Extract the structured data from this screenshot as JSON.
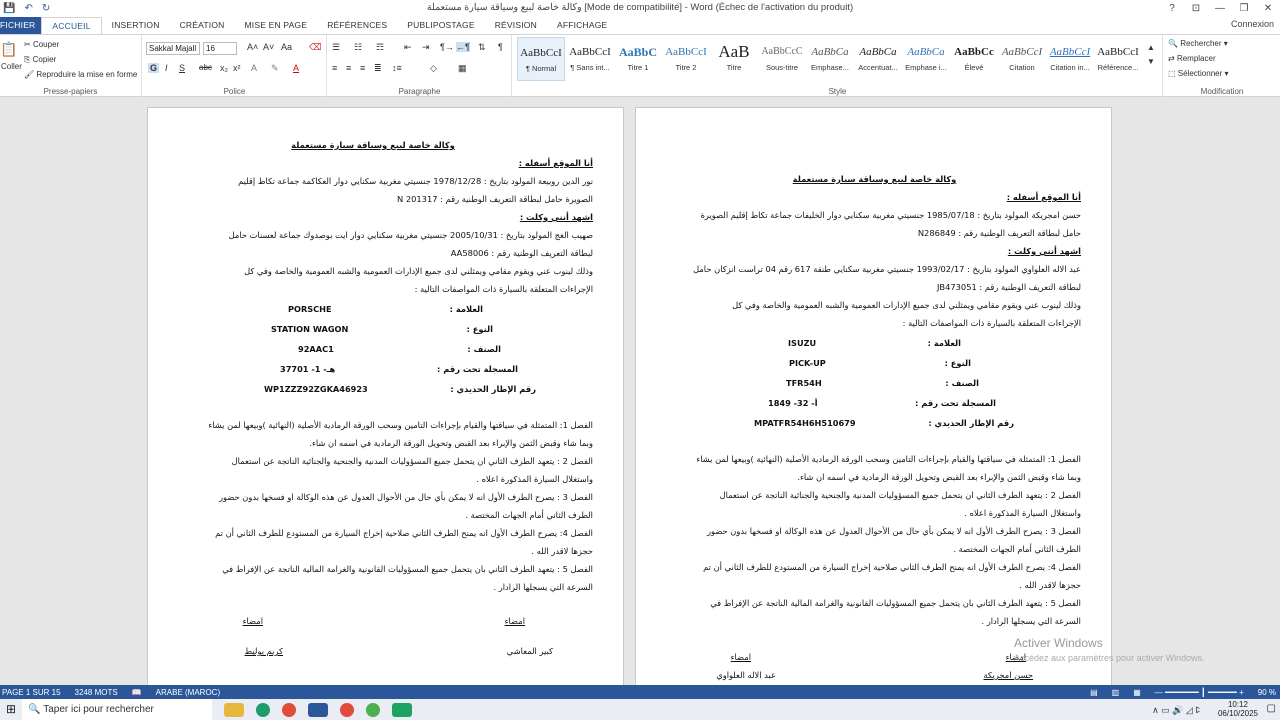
{
  "window": {
    "title": "وكالة خاصة لبيع وسياقة سيارة مستعملة [Mode de compatibilité] - Word (Échec de l'activation du produit)",
    "buttons": [
      "?",
      "⊡",
      "—",
      "❐",
      "✕"
    ]
  },
  "tabs": {
    "file": "FICHIER",
    "items": [
      "ACCUEIL",
      "INSERTION",
      "CRÉATION",
      "MISE EN PAGE",
      "RÉFÉRENCES",
      "PUBLIPOSTAGE",
      "RÉVISION",
      "AFFICHAGE"
    ],
    "account": "Connexion"
  },
  "ribbon": {
    "clipboard": {
      "paste": "Coller",
      "cut": "Couper",
      "copy": "Copier",
      "format_painter": "Reproduire la mise en forme",
      "label": "Presse-papiers"
    },
    "font": {
      "name": "Sakkal Majall",
      "size": "16",
      "label": "Police"
    },
    "paragraph": {
      "label": "Paragraphe"
    },
    "styles": {
      "label": "Style",
      "items": [
        {
          "preview": "AaBbCcI",
          "name": "¶ Normal"
        },
        {
          "preview": "AaBbCcI",
          "name": "¶ Sans int..."
        },
        {
          "preview": "AaBbC",
          "name": "Titre 1"
        },
        {
          "preview": "AaBbCcI",
          "name": "Titre 2"
        },
        {
          "preview": "AaB",
          "name": "Titre"
        },
        {
          "preview": "AaBbCcC",
          "name": "Sous-titre"
        },
        {
          "preview": "AaBbCa",
          "name": "Emphase..."
        },
        {
          "preview": "AaBbCa",
          "name": "Accentuat..."
        },
        {
          "preview": "AaBbCa",
          "name": "Emphase i..."
        },
        {
          "preview": "AaBbCc",
          "name": "Élevé"
        },
        {
          "preview": "AaBbCcI",
          "name": "Citation"
        },
        {
          "preview": "AaBbCcI",
          "name": "Citation in..."
        },
        {
          "preview": "AaBbCcI",
          "name": "Référence..."
        }
      ]
    },
    "editing": {
      "find": "Rechercher",
      "replace": "Remplacer",
      "select": "Sélectionner",
      "label": "Modification"
    }
  },
  "doc_left": {
    "title": "وكالة خاصة لبيع وسياقة سيارة مستعملة",
    "signer_head": "أنا الموقع أسفله :",
    "l1": "نور الدين روبيعة المولود بتاريخ : 1978/12/28 جنسيتي مغربية سكنايي  دوار العكاكمة جماعة تكاط إقليم",
    "l2": "الصويرة حامل لبطاقة التعريف الوطنية رقم : N 201317",
    "witness_head": "اشهد أنني وكلت :",
    "l3": "صهيب الغج المولود بتاريخ : 2005/10/31 جنسيتي مغربية سكنايي  دوار ايت بوصدوك جماعة لعسنات  حامل",
    "l4": "لبطاقة التعريف الوطنية رقم :  AA58006",
    "l5": "وذلك لينوب عني ويقوم مقامي  ويمثلني لدى جميع الإدارات العمومية والشبه العمومية والخاصة  وفي كل",
    "l6": "الإجراءات المتعلقة بالسيارة ذات المواصفات التالية :",
    "k1": "العلامة :",
    "v1": "PORSCHE",
    "k2": "النوع :",
    "v2": "STATION WAGON",
    "k3": "الصنف :",
    "v3": "92AAC1",
    "k4": "المسجلة تحت رقم :",
    "v4": "37701 -هـ- 1",
    "k5": "رقم الإطار الحديدي :",
    "v5": "WP1ZZZ92ZGKA46923",
    "a1": "الفصل 1: المتمثلة في سياقتها والقيام بإجراءات التامين وسحب الورقة الرمادية الأصلية (النهائية )وبيعها لمن يشاء",
    "a1b": "وبما شاء وقبض الثمن والإبراء بعد القبض وتحويل الورقة الرمادية في اسمه ان شاء.",
    "a2": "الفصل 2 : يتعهد الطرف الثاني ان يتحمل جميع المسؤوليات المدنية والجنحية والجنائية الناتجة عن استعمال",
    "a2b": "واستغلال السيارة المذكورة اعلاه .",
    "a3": "الفصل 3 : يصرح الطرف الأول انه لا يمكن بأي حال من الأحوال العدول عن هذه الوكالة او فسخها بدون حضور",
    "a3b": "الطرف الثاني أمام الجهات المختصة .",
    "a4": "الفصل 4: يصرح الطرف الأول انه يمنح الطرف الثاني صلاحية إخراج السيارة من المستودع للطرف الثاني أن تم",
    "a4b": "حجزها لاقدر الله .",
    "a5": "الفصل 5 : يتعهد الطرف الثاني بان يتحمل جميع المسؤوليات القانونية والغرامة المالية الناتجة عن الإفراط في",
    "a5b": "السرعة التي يسجلها الرادار .",
    "sig_a": "امضاء",
    "sig_b": "امضاء",
    "name_a": "كبير المعاشي",
    "name_b": "كريم بوليط"
  },
  "doc_right": {
    "title": "وكالة خاصة لبيع وسياقة سيارة مستعملة",
    "signer_head": "أنا الموقع أسفله :",
    "l1": "حسن امجريكة المولود بتاريخ : 1985/07/18 جنسيتي مغربية سكنايي  دوار الخليفات جماعة تكاط إقليم الصويرة",
    "l2": "حامل لبطاقة التعريف الوطنية رقم : N286849",
    "witness_head": "اشهد أنني وكلت :",
    "l3": "عبد الاله العلواوي المولود بتاريخ : 1993/02/17  جنسيتي مغربية سكنايي  طنقة 617 رقم 04 تراست انزكان  حامل",
    "l4": "لبطاقة التعريف الوطنية رقم :  JB473051",
    "l5": "وذلك لينوب عني ويقوم مقامي  ويمثلني لدى جميع الإدارات العمومية والشبه العمومية والخاصة  وفي كل",
    "l6": "الإجراءات المتعلقة بالسيارة ذات المواصفات التالية :",
    "k1": "العلامة :",
    "v1": "ISUZU",
    "k2": "النوع :",
    "v2": "PICK-UP",
    "k3": "الصنف :",
    "v3": "TFR54H",
    "k4": "المسجلة تحت رقم :",
    "v4": "1849 -أ- 32",
    "k5": "رقم الإطار الحديدي :",
    "v5": "MPATFR54H6H510679",
    "a1": "الفصل 1: المتمثلة في سياقتها والقيام بإجراءات التامين وسحب الورقة الرمادية الأصلية (النهائية )وبيعها لمن يشاء",
    "a1b": "وبما شاء وقبض الثمن والإبراء بعد القبض وتحويل الورقة الرمادية في اسمه ان شاء.",
    "a2": "الفصل 2 : يتعهد الطرف الثاني ان يتحمل جميع المسؤوليات المدنية والجنحية والجنائية الناتجة عن استعمال",
    "a2b": "واستغلال السيارة المذكورة اعلاه .",
    "a3": "الفصل 3 : يصرح الطرف الأول انه لا يمكن بأي حال من الأحوال العدول عن هذه الوكالة او فسخها بدون حضور",
    "a3b": "الطرف الثاني أمام الجهات المختصة .",
    "a4": "الفصل 4: يصرح الطرف الأول انه يمنح الطرف الثاني صلاحية إخراج السيارة من المستودع للطرف الثاني أن تم",
    "a4b": "حجزها لاقدر الله .",
    "a5": "الفصل 5 : يتعهد الطرف الثاني بان يتحمل جميع المسؤوليات القانونية والغرامة المالية الناتجة عن الإفراط في",
    "a5b": "السرعة التي يسجلها الرادار .",
    "sig_a": "امضاء",
    "sig_b": "امضاء",
    "name_a": "حسن امجريكة",
    "name_b": "عبد الاله العلواوي"
  },
  "watermark": {
    "line1": "Activer Windows",
    "line2": "Accédez aux paramètres pour activer Windows."
  },
  "status": {
    "page": "PAGE 1 SUR 15",
    "words": "3248 MOTS",
    "lang": "ARABE (MAROC)",
    "zoom": "90 %"
  },
  "taskbar": {
    "search_placeholder": "Taper ici pour rechercher",
    "time": "10:12",
    "date": "06/10/2025"
  },
  "colors": {
    "accent": "#2b579a"
  }
}
